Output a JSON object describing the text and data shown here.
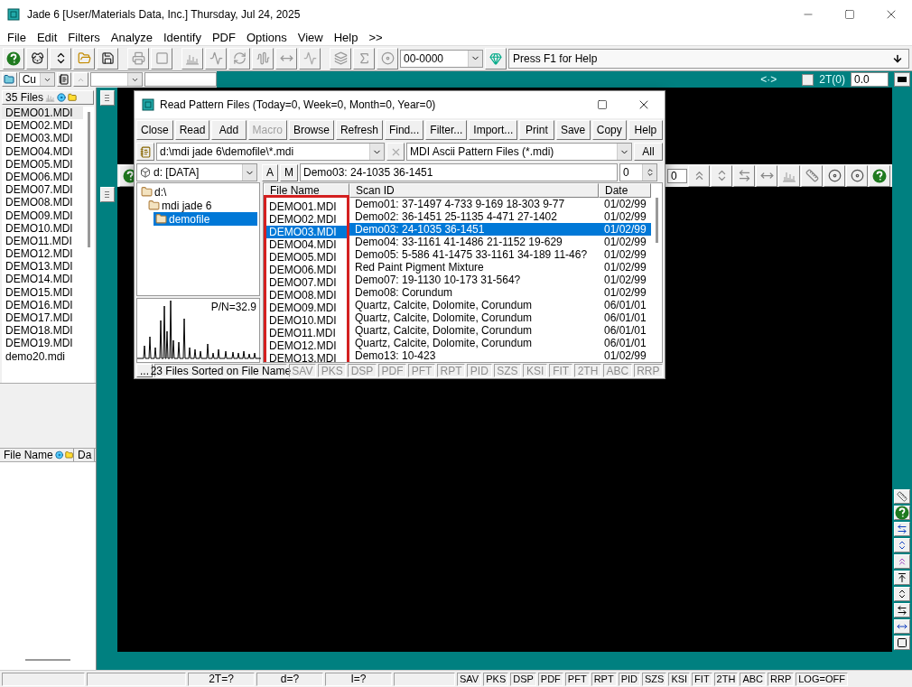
{
  "window": {
    "title": "Jade 6 [User/Materials Data, Inc.] Thursday, Jul 24, 2025"
  },
  "menu": [
    "File",
    "Edit",
    "Filters",
    "Analyze",
    "Identify",
    "PDF",
    "Options",
    "View",
    "Help",
    ">>"
  ],
  "toolbar": {
    "pattern_combo": "00-0000",
    "help_text": "Press F1 for Help"
  },
  "toolbar2": {
    "radiation": "Cu",
    "cursor_symbol": "<·>",
    "zero_label": "2T(0)",
    "zero_checked": false,
    "zero_value": "0.0"
  },
  "file_list": {
    "header": "35 Files",
    "items": [
      {
        "name": "DEMO01.MDI",
        "selected": true
      },
      {
        "name": "DEMO02.MDI",
        "selected": false
      },
      {
        "name": "DEMO03.MDI",
        "selected": false
      },
      {
        "name": "DEMO04.MDI",
        "selected": false
      },
      {
        "name": "DEMO05.MDI",
        "selected": false
      },
      {
        "name": "DEMO06.MDI",
        "selected": false
      },
      {
        "name": "DEMO07.MDI",
        "selected": false
      },
      {
        "name": "DEMO08.MDI",
        "selected": false
      },
      {
        "name": "DEMO09.MDI",
        "selected": false
      },
      {
        "name": "DEMO10.MDI",
        "selected": false
      },
      {
        "name": "DEMO11.MDI",
        "selected": false
      },
      {
        "name": "DEMO12.MDI",
        "selected": false
      },
      {
        "name": "DEMO13.MDI",
        "selected": false
      },
      {
        "name": "DEMO14.MDI",
        "selected": false
      },
      {
        "name": "DEMO15.MDI",
        "selected": false
      },
      {
        "name": "DEMO16.MDI",
        "selected": false
      },
      {
        "name": "DEMO17.MDI",
        "selected": false
      },
      {
        "name": "DEMO18.MDI",
        "selected": false
      },
      {
        "name": "DEMO19.MDI",
        "selected": false
      },
      {
        "name": "demo20.mdi",
        "selected": false
      }
    ]
  },
  "lower_list": {
    "columns": [
      "File Name",
      "Da"
    ]
  },
  "chart_window": {
    "toolbar_field": "0"
  },
  "dialog": {
    "title": "Read Pattern Files (Today=0, Week=0, Month=0, Year=0)",
    "buttons": [
      {
        "label": "Close",
        "disabled": false
      },
      {
        "label": "Read",
        "disabled": false
      },
      {
        "label": "Add",
        "disabled": false
      },
      {
        "label": "Macro",
        "disabled": true
      },
      {
        "label": "Browse",
        "disabled": false
      },
      {
        "label": "Refresh",
        "disabled": false
      },
      {
        "label": "Find...",
        "disabled": false
      },
      {
        "label": "Filter...",
        "disabled": false
      },
      {
        "label": "Import...",
        "disabled": false
      },
      {
        "label": "Print",
        "disabled": false
      },
      {
        "label": "Save",
        "disabled": false
      },
      {
        "label": "Copy",
        "disabled": false
      },
      {
        "label": "Help",
        "disabled": false
      }
    ],
    "path": "d:\\mdi jade 6\\demofile\\*.mdi",
    "file_type": "MDI Ascii Pattern Files (*.mdi)",
    "all_button": "All",
    "drive": "d: [DATA]",
    "a_button": "A",
    "m_button": "M",
    "scan_id": "Demo03: 24-1035 36-1451",
    "spin_value": "0",
    "tree": [
      {
        "label": "d:\\",
        "selected": false,
        "children": [
          {
            "label": "mdi jade 6",
            "selected": false,
            "children": [
              {
                "label": "demofile",
                "selected": true
              }
            ]
          }
        ]
      }
    ],
    "preview_label": "P/N=32.9",
    "table": {
      "highlight_box": true,
      "columns": [
        "File Name",
        "Scan ID",
        "Date"
      ],
      "rows": [
        {
          "file": "DEMO01.MDI",
          "scan_id": "Demo01: 37-1497 4-733 9-169 18-303 9-77",
          "date": "01/02/99",
          "selected": false
        },
        {
          "file": "DEMO02.MDI",
          "scan_id": "Demo02: 36-1451 25-1135 4-471 27-1402",
          "date": "01/02/99",
          "selected": false
        },
        {
          "file": "DEMO03.MDI",
          "scan_id": "Demo03: 24-1035 36-1451",
          "date": "01/02/99",
          "selected": true
        },
        {
          "file": "DEMO04.MDI",
          "scan_id": "Demo04: 33-1161 41-1486 21-1152 19-629",
          "date": "01/02/99",
          "selected": false
        },
        {
          "file": "DEMO05.MDI",
          "scan_id": "Demo05: 5-586 41-1475 33-1161 34-189 11-46?",
          "date": "01/02/99",
          "selected": false
        },
        {
          "file": "DEMO06.MDI",
          "scan_id": "Red Paint Pigment Mixture",
          "date": "01/02/99",
          "selected": false
        },
        {
          "file": "DEMO07.MDI",
          "scan_id": "Demo07: 19-1130 10-173 31-564?",
          "date": "01/02/99",
          "selected": false
        },
        {
          "file": "DEMO08.MDI",
          "scan_id": "Demo08: Corundum",
          "date": "01/02/99",
          "selected": false
        },
        {
          "file": "DEMO09.MDI",
          "scan_id": "Quartz, Calcite, Dolomite, Corundum",
          "date": "06/01/01",
          "selected": false
        },
        {
          "file": "DEMO10.MDI",
          "scan_id": "Quartz, Calcite, Dolomite, Corundum",
          "date": "06/01/01",
          "selected": false
        },
        {
          "file": "DEMO11.MDI",
          "scan_id": "Quartz, Calcite, Dolomite, Corundum",
          "date": "06/01/01",
          "selected": false
        },
        {
          "file": "DEMO12.MDI",
          "scan_id": "Quartz, Calcite, Dolomite, Corundum",
          "date": "06/01/01",
          "selected": false
        },
        {
          "file": "DEMO13.MDI",
          "scan_id": "Demo13: 10-423",
          "date": "01/02/99",
          "selected": false
        }
      ]
    },
    "status_more": "...",
    "status_text": "23 Files Sorted on File Name",
    "flags": [
      {
        "label": "SAV",
        "disabled": true
      },
      {
        "label": "PKS",
        "disabled": true
      },
      {
        "label": "DSP",
        "disabled": true
      },
      {
        "label": "PDF",
        "disabled": true
      },
      {
        "label": "PFT",
        "disabled": true
      },
      {
        "label": "RPT",
        "disabled": true
      },
      {
        "label": "PID",
        "disabled": true
      },
      {
        "label": "SZS",
        "disabled": true
      },
      {
        "label": "KSI",
        "disabled": true
      },
      {
        "label": "FIT",
        "disabled": true
      },
      {
        "label": "2TH",
        "disabled": true
      },
      {
        "label": "ABC",
        "disabled": true
      },
      {
        "label": "RRP",
        "disabled": true
      }
    ]
  },
  "status_bar": {
    "readouts": [
      "2T=?",
      "d=?",
      "I=?"
    ],
    "flags": [
      "SAV",
      "PKS",
      "DSP",
      "PDF",
      "PFT",
      "RPT",
      "PID",
      "SZS",
      "KSI",
      "FIT",
      "2TH",
      "ABC",
      "RRP",
      "LOG=OFF"
    ]
  }
}
